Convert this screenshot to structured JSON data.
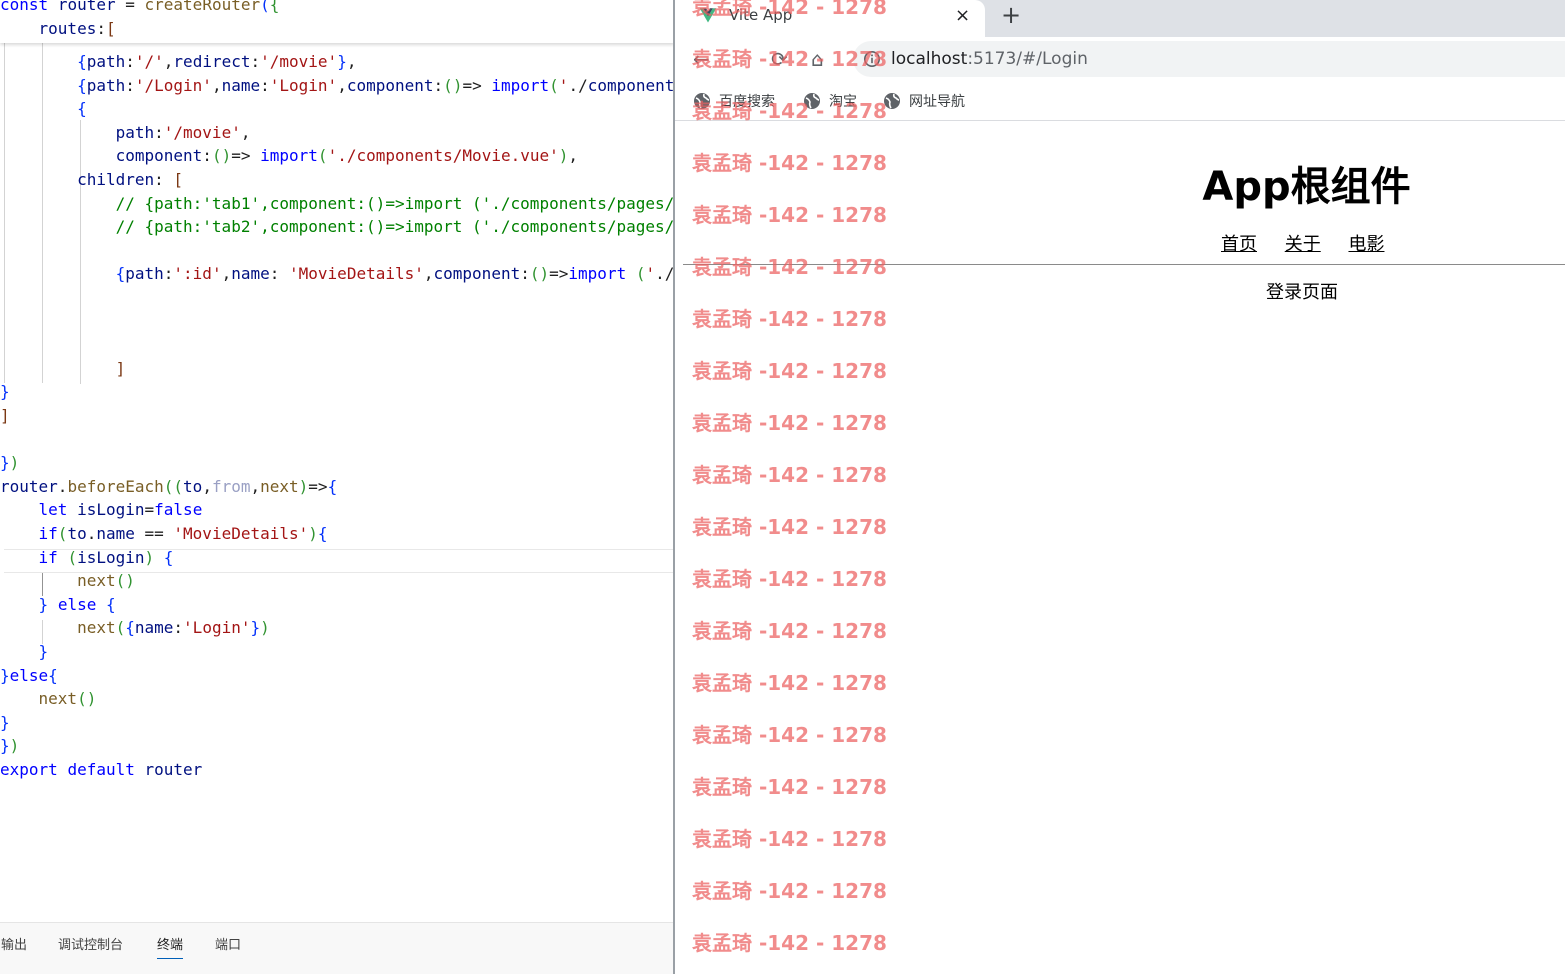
{
  "editor": {
    "sticky_lines": [
      {
        "html_id": "s1",
        "text": "const router = createRouter({"
      },
      {
        "html_id": "s2",
        "text": "    routes:["
      }
    ],
    "lines": [
      "        {path:'/',redirect:'/movie'},",
      "        {path:'/Login',name:'Login',component:()=> import('./component",
      "        {",
      "            path:'/movie',",
      "            component:()=> import('./components/Movie.vue'),",
      "        children: [",
      "            // {path:'tab1',component:()=>import ('./components/pages/",
      "            // {path:'tab2',component:()=>import ('./components/pages/",
      "",
      "            {path:':id',name: 'MovieDetails',component:()=>import ('./",
      "",
      "",
      "",
      "            ]",
      "}",
      "]",
      "",
      "})",
      "router.beforeEach((to,from,next)=>{",
      "    let isLogin=false",
      "    if(to.name == 'MovieDetails'){",
      "    if (isLogin) {",
      "        next()",
      "    } else {",
      "        next({name:'Login'})",
      "    }",
      "}else{",
      "    next()",
      "}",
      "})",
      "export default router"
    ]
  },
  "panel": {
    "tabs": [
      {
        "label": "输出",
        "active": false
      },
      {
        "label": "调试控制台",
        "active": false
      },
      {
        "label": "终端",
        "active": true
      },
      {
        "label": "端口",
        "active": false
      }
    ]
  },
  "browser": {
    "tab": {
      "title": "Vite App",
      "close_glyph": "×"
    },
    "new_tab_glyph": "+",
    "toolbar": {
      "back_glyph": "←",
      "reload_glyph": "⟳",
      "home_glyph": "⌂"
    },
    "url": {
      "host": "localhost",
      "rest": ":5173/#/Login"
    },
    "bookmarks": [
      {
        "label": "百度搜索"
      },
      {
        "label": "淘宝"
      },
      {
        "label": "网址导航"
      }
    ],
    "page": {
      "title": "App根组件",
      "nav": [
        {
          "label": "首页"
        },
        {
          "label": "关于"
        },
        {
          "label": "电影"
        }
      ],
      "body_text": "登录页面"
    }
  },
  "watermark": {
    "text": "袁孟琦 -142 - 1278",
    "color": "#ec6060"
  }
}
